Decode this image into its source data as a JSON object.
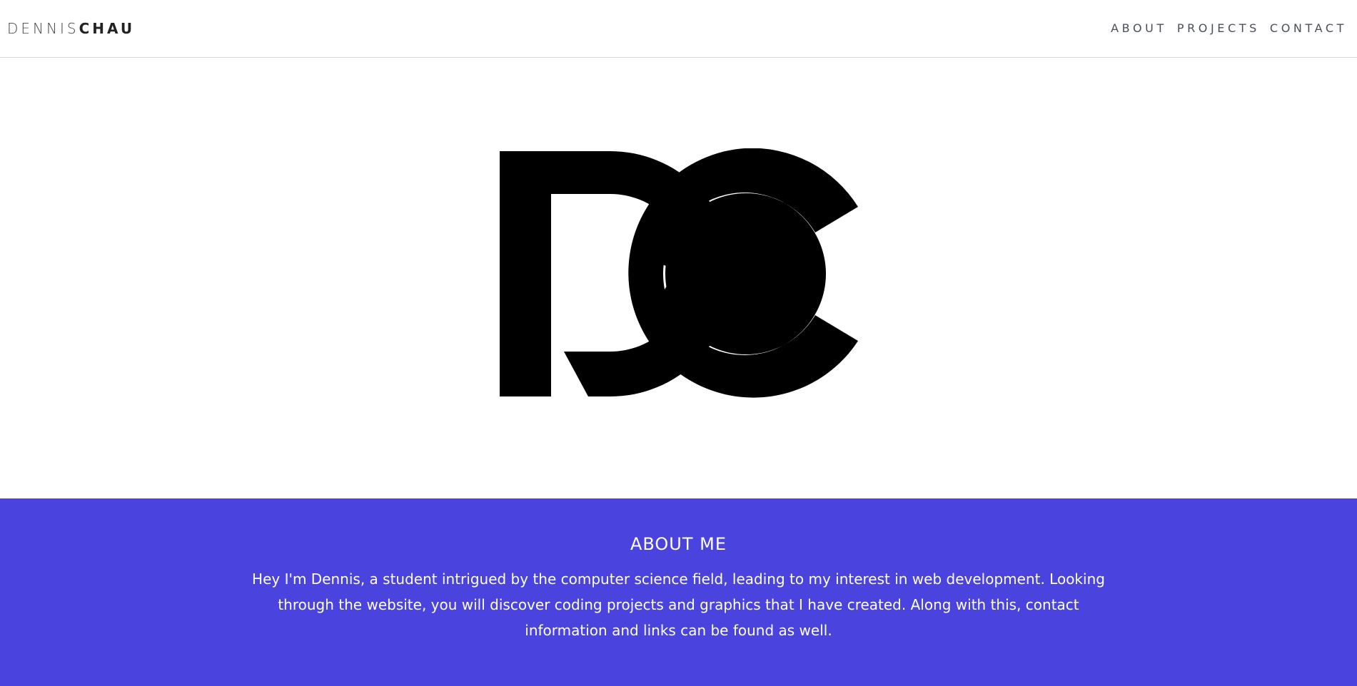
{
  "brand": {
    "first": "DENNIS",
    "last": "CHAU"
  },
  "nav": {
    "items": [
      {
        "label": "ABOUT"
      },
      {
        "label": "PROJECTS"
      },
      {
        "label": "CONTACT"
      }
    ]
  },
  "hero": {
    "logo_icon": "dc-monogram-logo",
    "logo_color": "#000000"
  },
  "about": {
    "title": "ABOUT ME",
    "body": "Hey I'm Dennis, a student intrigued by the computer science field, leading to my interest in web development. Looking through the website, you will discover coding projects and graphics that I have created. Along with this, contact information and links can be found as well.",
    "background": "#4b43dd"
  }
}
